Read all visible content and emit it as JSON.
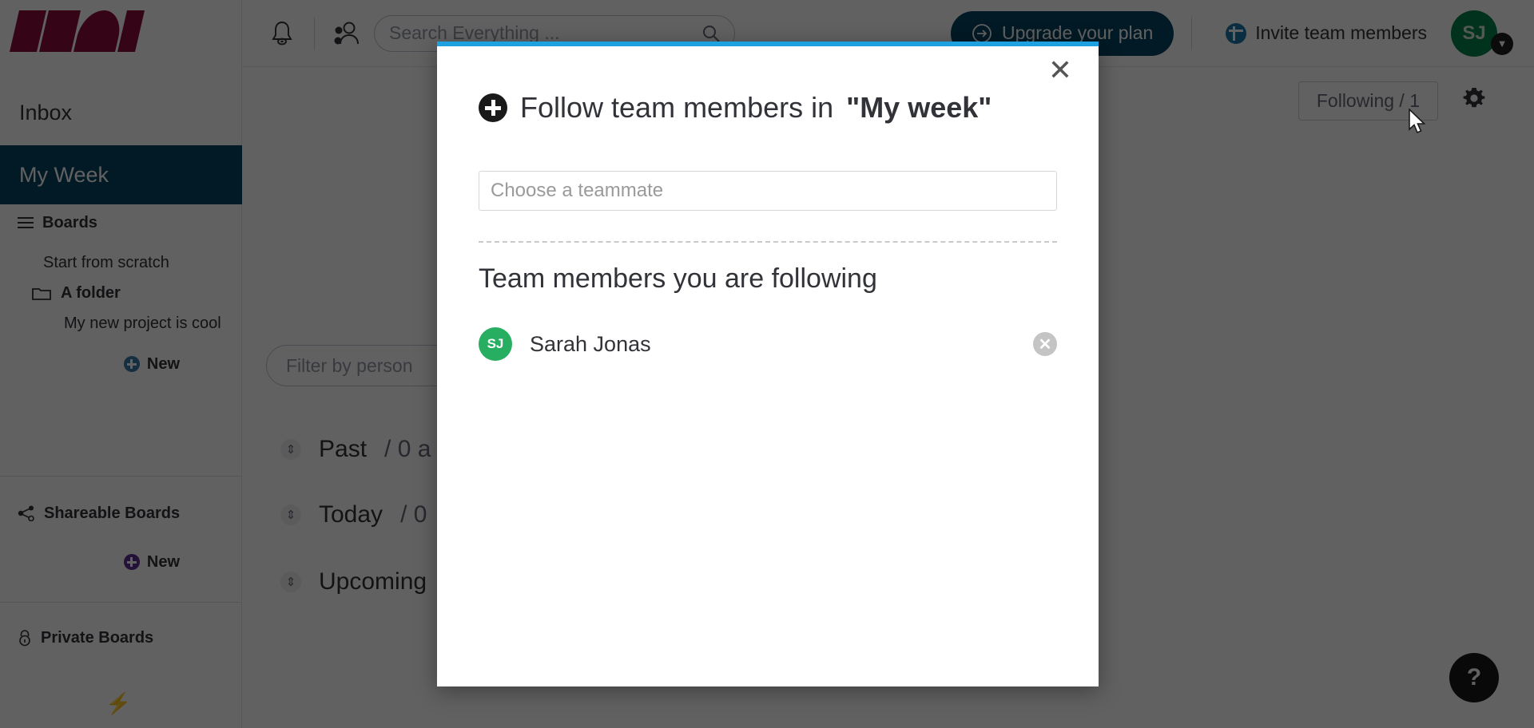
{
  "app": {
    "logo_alt": "company-logo",
    "brand_color": "#8b0b3a"
  },
  "topbar": {
    "notifications_icon": "bell-icon",
    "team_icon": "people-icon",
    "search": {
      "placeholder": "Search Everything ...",
      "icon": "search-icon"
    },
    "upgrade_label": "Upgrade your plan",
    "upgrade_icon": "arrow-right-circle-icon",
    "invite_label": "Invite team members",
    "invite_icon": "plus-circle-icon",
    "avatar_initials": "SJ",
    "avatar_color": "#00854d",
    "avatar_chevron": "▼"
  },
  "sidebar": {
    "inbox_label": "Inbox",
    "my_week_label": "My Week",
    "my_week_active_color": "#064463",
    "boards": {
      "label": "Boards",
      "icon": "hamburger-icon",
      "items": [
        {
          "label": "Start from scratch",
          "icon": ""
        },
        {
          "label": "A folder",
          "icon": "folder-icon"
        },
        {
          "label": "My new project is cool",
          "icon": ""
        }
      ],
      "new_label": "New",
      "new_icon_color": "#3b7ca8"
    },
    "shareable": {
      "label": "Shareable Boards",
      "icon": "share-icon",
      "new_label": "New",
      "new_icon_color": "#5c2d91"
    },
    "private": {
      "label": "Private Boards",
      "icon": "lock-icon"
    },
    "bolt_icon": "lightning-bolt-icon"
  },
  "main": {
    "following_button_label": "Following / 1",
    "settings_icon": "gear-icon",
    "illustration": "coffee-mugs-illustration",
    "filter_placeholder": "Filter by person",
    "groups": [
      {
        "label": "Past",
        "count": "/ 0 a",
        "toggle": "⇕"
      },
      {
        "label": "Today",
        "count": "/ 0",
        "toggle": "⇕"
      },
      {
        "label": "Upcoming",
        "count": "",
        "toggle": "⇕"
      }
    ],
    "help_label": "?"
  },
  "modal": {
    "accent_color": "#1da1e0",
    "close_icon": "close-icon",
    "title_icon": "plus-circle-icon",
    "title_prefix": "Follow team members in ",
    "title_board": "\"My week\"",
    "input_placeholder": "Choose a teammate",
    "input_value": "",
    "subtitle": "Team members you are following",
    "members": [
      {
        "initials": "SJ",
        "name": "Sarah Jonas",
        "avatar_color": "#27ae60",
        "remove_icon": "remove-circle-icon"
      }
    ]
  }
}
